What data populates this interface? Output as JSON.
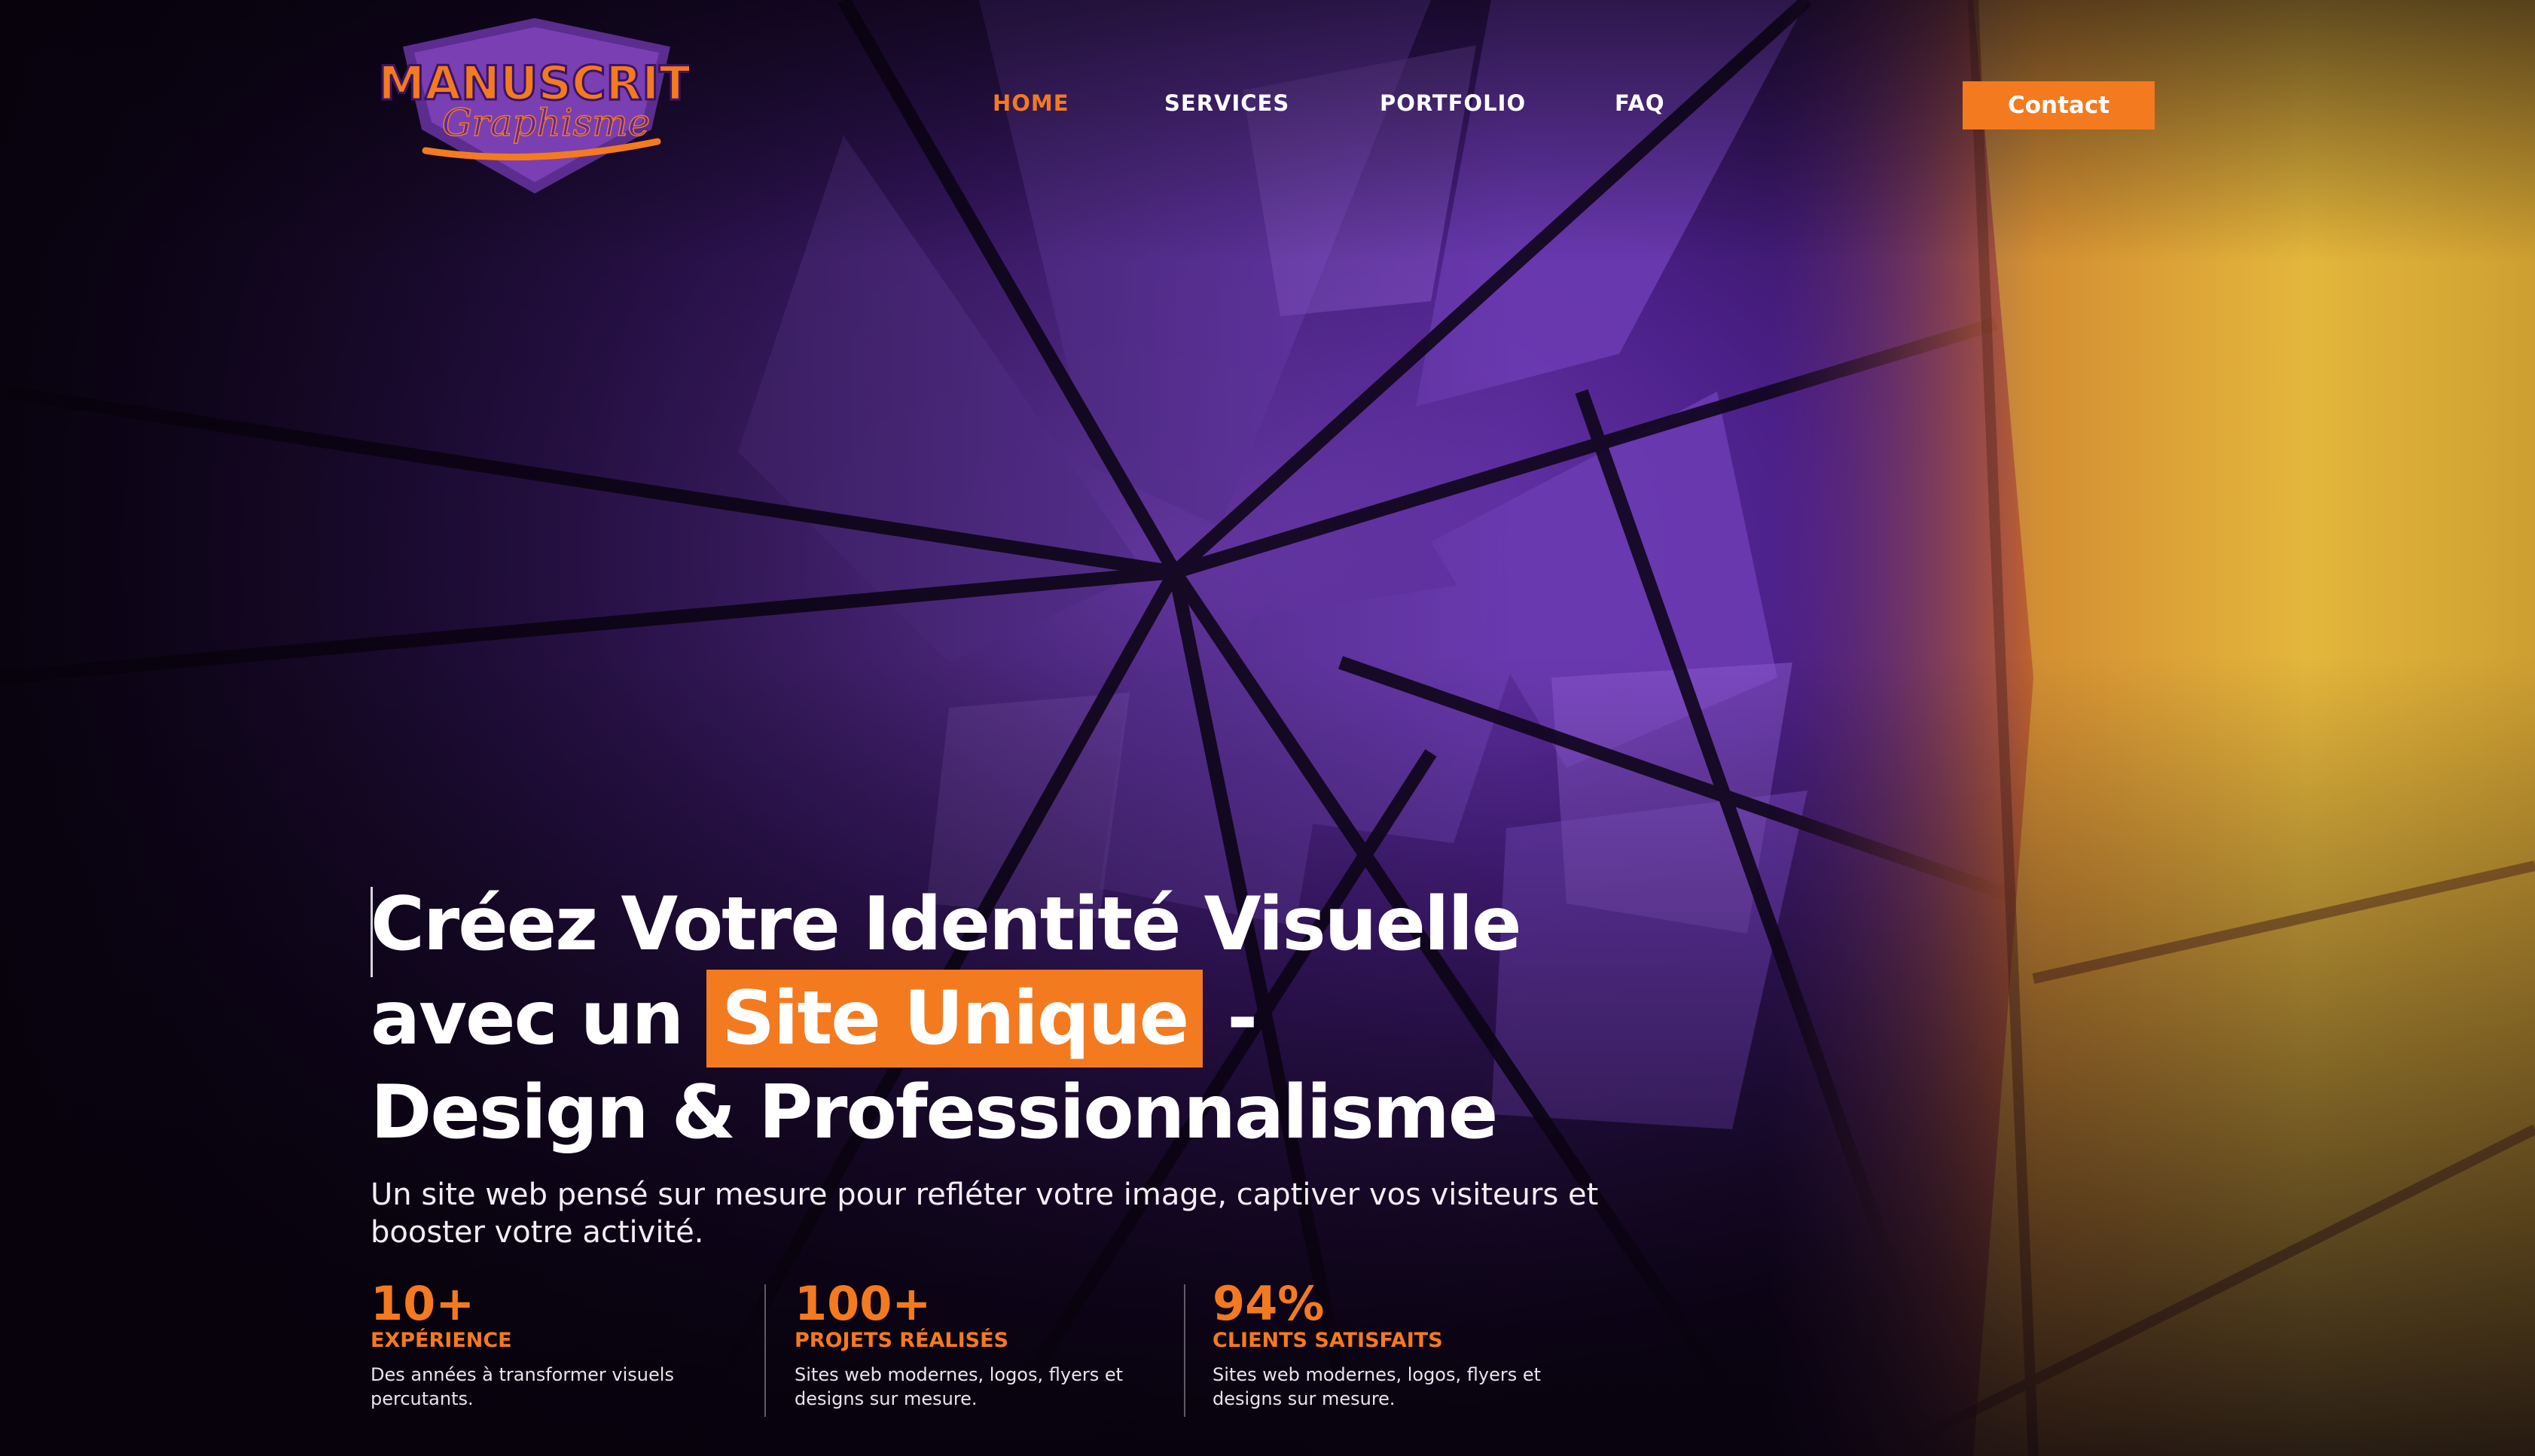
{
  "brand": {
    "logo_main": "MANUSCRIT",
    "logo_script": "Graphisme"
  },
  "nav": {
    "items": [
      {
        "label": "HOME",
        "active": true
      },
      {
        "label": "SERVICES",
        "active": false
      },
      {
        "label": "PORTFOLIO",
        "active": false
      },
      {
        "label": "FAQ",
        "active": false
      }
    ],
    "contact_label": "Contact"
  },
  "hero": {
    "line1": "Créez Votre Identité Visuelle",
    "line2_pre": "avec un ",
    "line2_highlight": "Site Unique",
    "line2_post": " -",
    "line3": "Design & Professionnalisme",
    "subtitle": "Un site web pensé sur mesure pour refléter votre image, captiver vos visiteurs et booster votre activité."
  },
  "stats": [
    {
      "value": "10+",
      "label": "EXPÉRIENCE",
      "desc": "Des années à transformer visuels percutants."
    },
    {
      "value": "100+",
      "label": "PROJETS RÉALISÉS",
      "desc": "Sites web modernes, logos, flyers et designs sur mesure."
    },
    {
      "value": "94%",
      "label": "CLIENTS SATISFAITS",
      "desc": "Sites web modernes, logos, flyers et designs sur mesure."
    }
  ],
  "colors": {
    "accent": "#f47a1f",
    "purple": "#5a2d9c",
    "dark": "#0b0410",
    "yellow": "#e8c53a"
  }
}
